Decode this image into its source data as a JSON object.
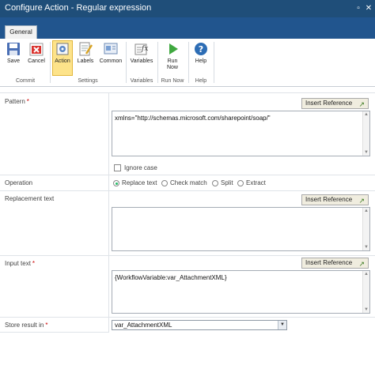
{
  "window": {
    "title": "Configure Action - Regular expression",
    "minimize_glyph": "▫",
    "close_glyph": "✕"
  },
  "tabs": [
    {
      "label": "General"
    }
  ],
  "ribbon": {
    "buttons": {
      "save": "Save",
      "cancel": "Cancel",
      "action": "Action",
      "labels": "Labels",
      "common": "Common",
      "variables": "Variables",
      "run_now": "Run Now",
      "help": "Help"
    },
    "groups": {
      "commit": "Commit",
      "settings": "Settings",
      "variables": "Variables",
      "run_now": "Run Now",
      "help": "Help"
    },
    "icons": {
      "save": "save-icon",
      "cancel": "cancel-icon",
      "action": "action-icon",
      "labels": "labels-icon",
      "common": "common-icon",
      "variables": "variables-icon",
      "run_now": "run-now-icon",
      "help": "help-icon"
    }
  },
  "form": {
    "pattern": {
      "label": "Pattern",
      "required_mark": "*",
      "insert_reference": "Insert Reference",
      "value": "xmlns=\"http://schemas.microsoft.com/sharepoint/soap/\"",
      "ignore_case_label": "Ignore case",
      "ignore_case_checked": false
    },
    "operation": {
      "label": "Operation",
      "options": [
        "Replace text",
        "Check match",
        "Split",
        "Extract"
      ],
      "selected": "Replace text"
    },
    "replacement": {
      "label": "Replacement text",
      "insert_reference": "Insert Reference",
      "value": ""
    },
    "input_text": {
      "label": "Input text",
      "required_mark": "*",
      "insert_reference": "Insert Reference",
      "value": "{WorkflowVariable:var_AttachmentXML}"
    },
    "store_result": {
      "label": "Store result in",
      "required_mark": "*",
      "selected": "var_AttachmentXML"
    }
  },
  "colors": {
    "titlebar": "#1f4e79",
    "tabstrip": "#21558e",
    "active_button": "#fde38a",
    "required": "#cc0000"
  }
}
